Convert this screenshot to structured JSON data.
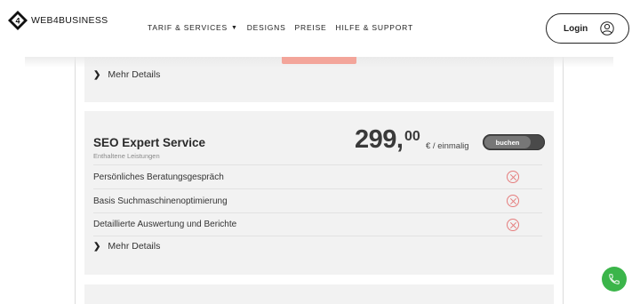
{
  "header": {
    "logo_text": "WEB4BUSINESS",
    "nav": [
      {
        "label": "TARIF & SERVICES",
        "has_caret": true
      },
      {
        "label": "DESIGNS"
      },
      {
        "label": "PREISE"
      },
      {
        "label": "HILFE & SUPPORT"
      }
    ],
    "login_label": "Login"
  },
  "prev_card": {
    "details_label": "Mehr Details"
  },
  "service": {
    "title": "SEO Expert Service",
    "subtitle": "Enthaltene Leistungen",
    "price_int": "299,",
    "price_dec": "00",
    "price_unit": "€ / einmalig",
    "book_label": "buchen",
    "features": [
      {
        "label": "Persönliches Beratungsgespräch",
        "included": false
      },
      {
        "label": "Basis Suchmaschinenoptimierung",
        "included": false
      },
      {
        "label": "Detaillierte Auswertung und Berichte",
        "included": false
      }
    ],
    "details_label": "Mehr Details"
  },
  "colors": {
    "accent": "#3bb54a",
    "cross": "#e57d7d",
    "cta": "#f3a59a"
  },
  "icons": {
    "phone": "phone-icon",
    "user": "user-icon",
    "x": "x-circle-icon"
  }
}
